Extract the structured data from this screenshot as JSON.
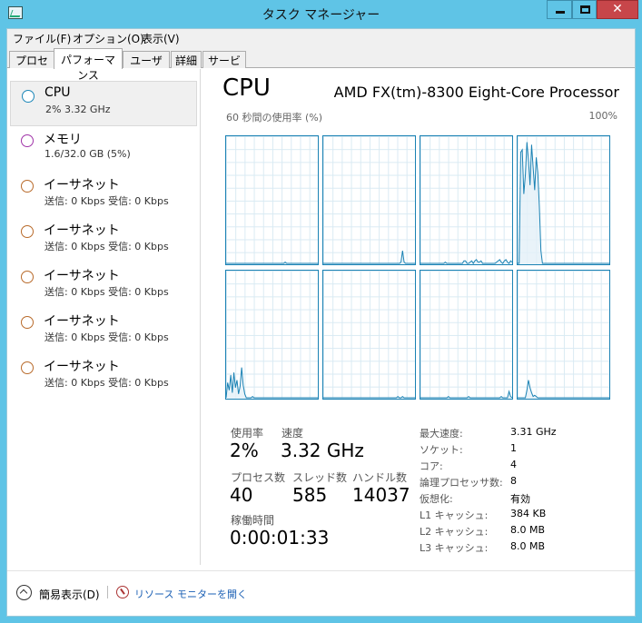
{
  "window": {
    "title": "タスク マネージャー",
    "close_glyph": "✕"
  },
  "menu": [
    "ファイル(F)",
    "オプション(O)",
    "表示(V)"
  ],
  "tabs": [
    {
      "label": "プロセス",
      "active": false
    },
    {
      "label": "パフォーマンス",
      "active": true
    },
    {
      "label": "ユーザー",
      "active": false
    },
    {
      "label": "詳細",
      "active": false
    },
    {
      "label": "サービス",
      "active": false
    }
  ],
  "sidebar": [
    {
      "title": "CPU",
      "sub": "2%  3.32 GHz",
      "color": "#1c87b8",
      "selected": true
    },
    {
      "title": "メモリ",
      "sub": "1.6/32.0 GB (5%)",
      "color": "#a033a8",
      "selected": false
    },
    {
      "title": "イーサネット",
      "sub": "送信: 0 Kbps 受信: 0 Kbps",
      "color": "#b86a2a",
      "selected": false
    },
    {
      "title": "イーサネット",
      "sub": "送信: 0 Kbps 受信: 0 Kbps",
      "color": "#b86a2a",
      "selected": false
    },
    {
      "title": "イーサネット",
      "sub": "送信: 0 Kbps 受信: 0 Kbps",
      "color": "#b86a2a",
      "selected": false
    },
    {
      "title": "イーサネット",
      "sub": "送信: 0 Kbps 受信: 0 Kbps",
      "color": "#b86a2a",
      "selected": false
    },
    {
      "title": "イーサネット",
      "sub": "送信: 0 Kbps 受信: 0 Kbps",
      "color": "#b86a2a",
      "selected": false
    }
  ],
  "panel": {
    "title": "CPU",
    "model": "AMD FX(tm)-8300 Eight-Core Processor",
    "graph_caption": "60 秒間の使用率 (%)",
    "graph_max": "100%",
    "graph_line_color": "#1a82b4",
    "graph_fill_color": "#e3f0f8",
    "core_graphs": [
      [
        0,
        0,
        0,
        0,
        0,
        0,
        0,
        0,
        0,
        0,
        0,
        0,
        0,
        0,
        0,
        0,
        0,
        0,
        0,
        0,
        0,
        0,
        0,
        0,
        0,
        0,
        0,
        0,
        0,
        0,
        0,
        0,
        0,
        0,
        0,
        0,
        0,
        0,
        1,
        0,
        0,
        0,
        0,
        0,
        0,
        0,
        0,
        0,
        0,
        0,
        0,
        0,
        0,
        0,
        0,
        0,
        0,
        0,
        0,
        0
      ],
      [
        0,
        0,
        0,
        0,
        0,
        0,
        0,
        0,
        0,
        0,
        0,
        0,
        0,
        0,
        0,
        0,
        0,
        0,
        0,
        0,
        0,
        0,
        0,
        0,
        0,
        0,
        0,
        0,
        0,
        0,
        0,
        0,
        0,
        0,
        0,
        0,
        0,
        0,
        0,
        0,
        0,
        0,
        0,
        0,
        0,
        0,
        0,
        0,
        0,
        0,
        1,
        10,
        1,
        0,
        0,
        0,
        0,
        0,
        0,
        0
      ],
      [
        0,
        0,
        0,
        0,
        0,
        0,
        0,
        0,
        0,
        0,
        0,
        0,
        0,
        0,
        0,
        0,
        1,
        0,
        0,
        0,
        0,
        0,
        0,
        0,
        0,
        0,
        0,
        0,
        2,
        2,
        0,
        0,
        1,
        2,
        0,
        2,
        3,
        1,
        1,
        2,
        0,
        0,
        0,
        0,
        0,
        0,
        0,
        0,
        0,
        1,
        2,
        3,
        1,
        0,
        2,
        3,
        1,
        0,
        2,
        1
      ],
      [
        0,
        0,
        88,
        90,
        55,
        70,
        96,
        82,
        62,
        94,
        76,
        58,
        84,
        72,
        45,
        10,
        0,
        0,
        0,
        0,
        0,
        0,
        0,
        0,
        0,
        0,
        0,
        0,
        0,
        0,
        0,
        0,
        0,
        0,
        0,
        0,
        0,
        0,
        0,
        0,
        0,
        0,
        0,
        0,
        0,
        0,
        0,
        0,
        0,
        0,
        0,
        0,
        0,
        0,
        0,
        0,
        0,
        0,
        0,
        0
      ],
      [
        0,
        12,
        6,
        18,
        4,
        20,
        8,
        14,
        3,
        9,
        24,
        10,
        3,
        0,
        0,
        0,
        0,
        1,
        0,
        0,
        0,
        0,
        0,
        0,
        0,
        0,
        0,
        0,
        0,
        0,
        0,
        0,
        0,
        0,
        0,
        0,
        0,
        0,
        0,
        0,
        0,
        0,
        0,
        0,
        0,
        0,
        0,
        0,
        0,
        0,
        0,
        0,
        0,
        0,
        0,
        0,
        0,
        0,
        0,
        0
      ],
      [
        0,
        0,
        0,
        0,
        0,
        0,
        0,
        0,
        0,
        0,
        0,
        0,
        0,
        0,
        0,
        0,
        0,
        0,
        0,
        0,
        0,
        0,
        0,
        0,
        0,
        0,
        0,
        0,
        0,
        0,
        0,
        0,
        0,
        0,
        0,
        0,
        0,
        0,
        0,
        0,
        0,
        0,
        0,
        0,
        0,
        0,
        0,
        0,
        1,
        0,
        0,
        1,
        0,
        0,
        0,
        0,
        0,
        0,
        0,
        0
      ],
      [
        0,
        0,
        0,
        0,
        0,
        0,
        0,
        0,
        0,
        0,
        0,
        0,
        0,
        0,
        0,
        0,
        0,
        0,
        1,
        0,
        0,
        0,
        0,
        0,
        0,
        0,
        0,
        0,
        0,
        0,
        0,
        1,
        0,
        0,
        0,
        0,
        0,
        0,
        0,
        0,
        0,
        0,
        0,
        0,
        0,
        0,
        0,
        0,
        0,
        0,
        0,
        0,
        1,
        0,
        0,
        0,
        0,
        5,
        1,
        0
      ],
      [
        0,
        0,
        0,
        0,
        0,
        0,
        6,
        14,
        8,
        4,
        1,
        2,
        1,
        0,
        0,
        0,
        0,
        0,
        0,
        0,
        0,
        0,
        0,
        0,
        0,
        0,
        0,
        0,
        0,
        0,
        0,
        0,
        0,
        0,
        0,
        0,
        0,
        0,
        0,
        0,
        0,
        0,
        0,
        0,
        0,
        0,
        0,
        0,
        0,
        0,
        0,
        0,
        0,
        0,
        0,
        0,
        0,
        0,
        0,
        0
      ]
    ],
    "stats": {
      "usage_label": "使用率",
      "usage_value": "2%",
      "speed_label": "速度",
      "speed_value": "3.32 GHz",
      "processes_label": "プロセス数",
      "processes_value": "40",
      "threads_label": "スレッド数",
      "threads_value": "585",
      "handles_label": "ハンドル数",
      "handles_value": "14037",
      "uptime_label": "稼働時間",
      "uptime_value": "0:00:01:33"
    },
    "details": [
      {
        "key": "最大速度:",
        "value": "3.31 GHz"
      },
      {
        "key": "ソケット:",
        "value": "1"
      },
      {
        "key": "コア:",
        "value": "4"
      },
      {
        "key": "論理プロセッサ数:",
        "value": "8"
      },
      {
        "key": "仮想化:",
        "value": "有効"
      },
      {
        "key": "L1 キャッシュ:",
        "value": "384 KB"
      },
      {
        "key": "L2 キャッシュ:",
        "value": "8.0 MB"
      },
      {
        "key": "L3 キャッシュ:",
        "value": "8.0 MB"
      }
    ]
  },
  "footer": {
    "fewer_details": "簡易表示(D)",
    "resource_monitor": "リソース モニターを開く"
  },
  "icons": {
    "app": "task-manager-icon",
    "fewer": "chevron-up-circle-icon",
    "resource_monitor": "resource-monitor-icon"
  }
}
